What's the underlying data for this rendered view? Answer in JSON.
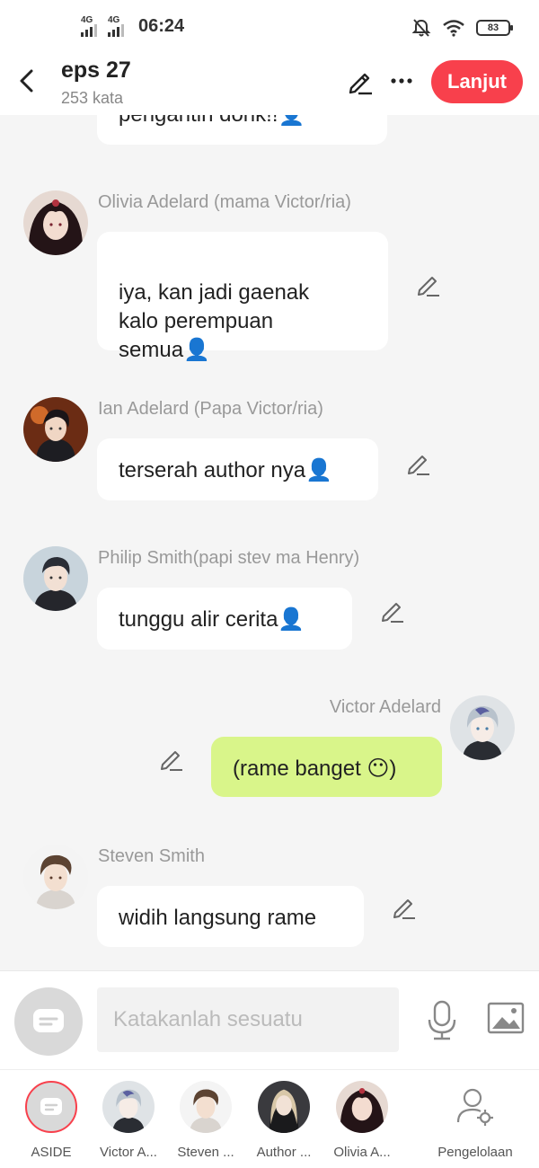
{
  "status": {
    "network1": "4G",
    "network2": "4G",
    "time": "06:24",
    "battery": "83"
  },
  "header": {
    "title": "eps 27",
    "word_count": "253 kata",
    "next_label": "Lanjut"
  },
  "messages": [
    {
      "text": "pengantin donk!!👤",
      "side": "left"
    },
    {
      "speaker": "Olivia Adelard (mama Victor/ria)",
      "text": "iya, kan jadi gaenak\nkalo perempuan\nsemua👤",
      "side": "left"
    },
    {
      "speaker": "Ian Adelard (Papa Victor/ria)",
      "text": "terserah author nya👤",
      "side": "left"
    },
    {
      "speaker": "Philip Smith(papi stev ma Henry)",
      "text": "tunggu alir cerita👤",
      "side": "left"
    },
    {
      "speaker": "Victor Adelard",
      "text": "(rame banget 😶)",
      "side": "right"
    },
    {
      "speaker": "Steven Smith",
      "text": "widih langsung rame",
      "side": "left"
    }
  ],
  "input": {
    "placeholder": "Katakanlah sesuatu"
  },
  "characters": [
    {
      "label": "ASIDE"
    },
    {
      "label": "Victor A..."
    },
    {
      "label": "Steven ..."
    },
    {
      "label": "Author ..."
    },
    {
      "label": "Olivia A..."
    },
    {
      "label": "Pengelolaan"
    }
  ],
  "colors": {
    "accent": "#f8404c",
    "my_bubble": "#d9f58a",
    "bubble": "#ffffff",
    "background": "#f5f5f5"
  },
  "icons": {
    "back": "chevron-left-icon",
    "edit": "pencil-icon",
    "more": "ellipsis-icon",
    "mic": "microphone-icon",
    "image": "image-icon",
    "aside": "message-icon",
    "manage": "user-gear-icon"
  }
}
